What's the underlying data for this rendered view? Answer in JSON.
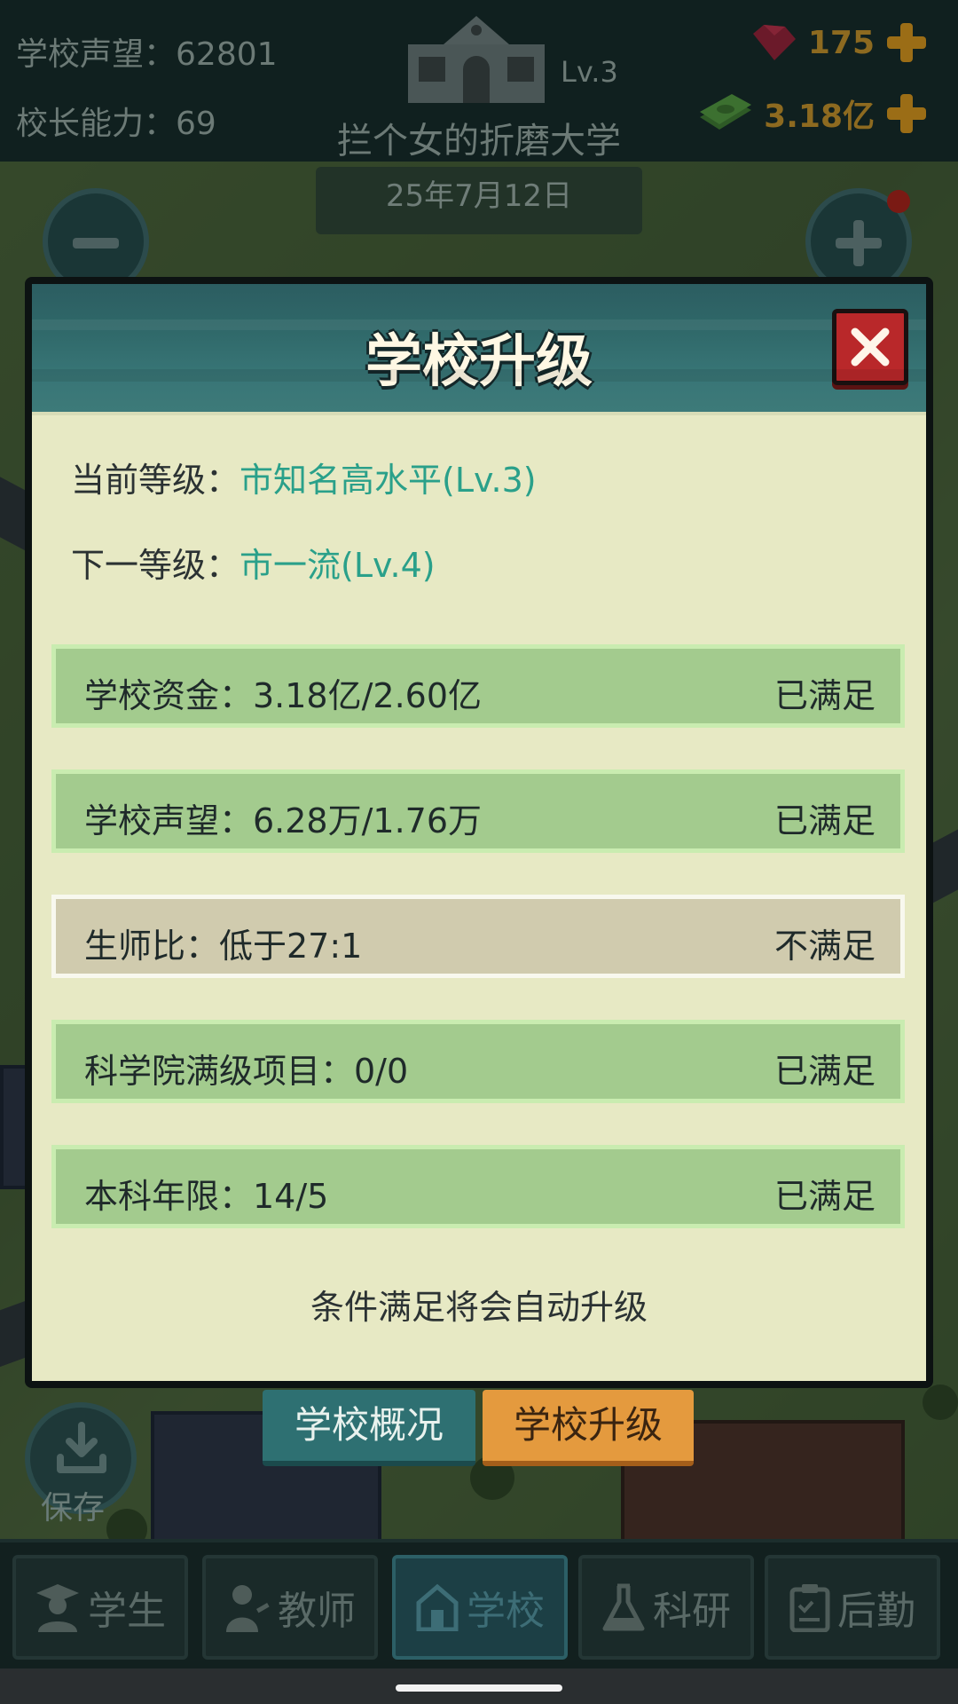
{
  "hud": {
    "reputation_label": "学校声望：",
    "reputation_value": "62801",
    "ability_label": "校长能力：",
    "ability_value": "69",
    "school_level": "Lv.3",
    "school_name": "拦个女的折磨大学",
    "gems": "175",
    "money": "3.18亿",
    "date": "25年7月12日"
  },
  "modal": {
    "title": "学校升级",
    "current_level_label": "当前等级：",
    "current_level_value": "市知名高水平(Lv.3)",
    "next_level_label": "下一等级：",
    "next_level_value": "市一流(Lv.4)",
    "requirements": [
      {
        "name": "学校资金：3.18亿/2.60亿",
        "state": "已满足",
        "met": true
      },
      {
        "name": "学校声望：6.28万/1.76万",
        "state": "已满足",
        "met": true
      },
      {
        "name": "生师比：低于27:1",
        "state": "不满足",
        "met": false
      },
      {
        "name": "科学院满级项目：0/0",
        "state": "已满足",
        "met": true
      },
      {
        "name": "本科年限：14/5",
        "state": "已满足",
        "met": true
      }
    ],
    "note": "条件满足将会自动升级"
  },
  "subtabs": {
    "overview": "学校概况",
    "upgrade": "学校升级"
  },
  "save_label": "保存",
  "nav": {
    "students": "学生",
    "teachers": "教师",
    "school": "学校",
    "research": "科研",
    "logistics": "后勤"
  },
  "colors": {
    "accent_teal": "#2aa08a",
    "met_row": "#a3cb8e",
    "unmet_row": "#d0cbae",
    "close_red": "#b9282a",
    "tab_active_orange": "#e49a3e"
  }
}
